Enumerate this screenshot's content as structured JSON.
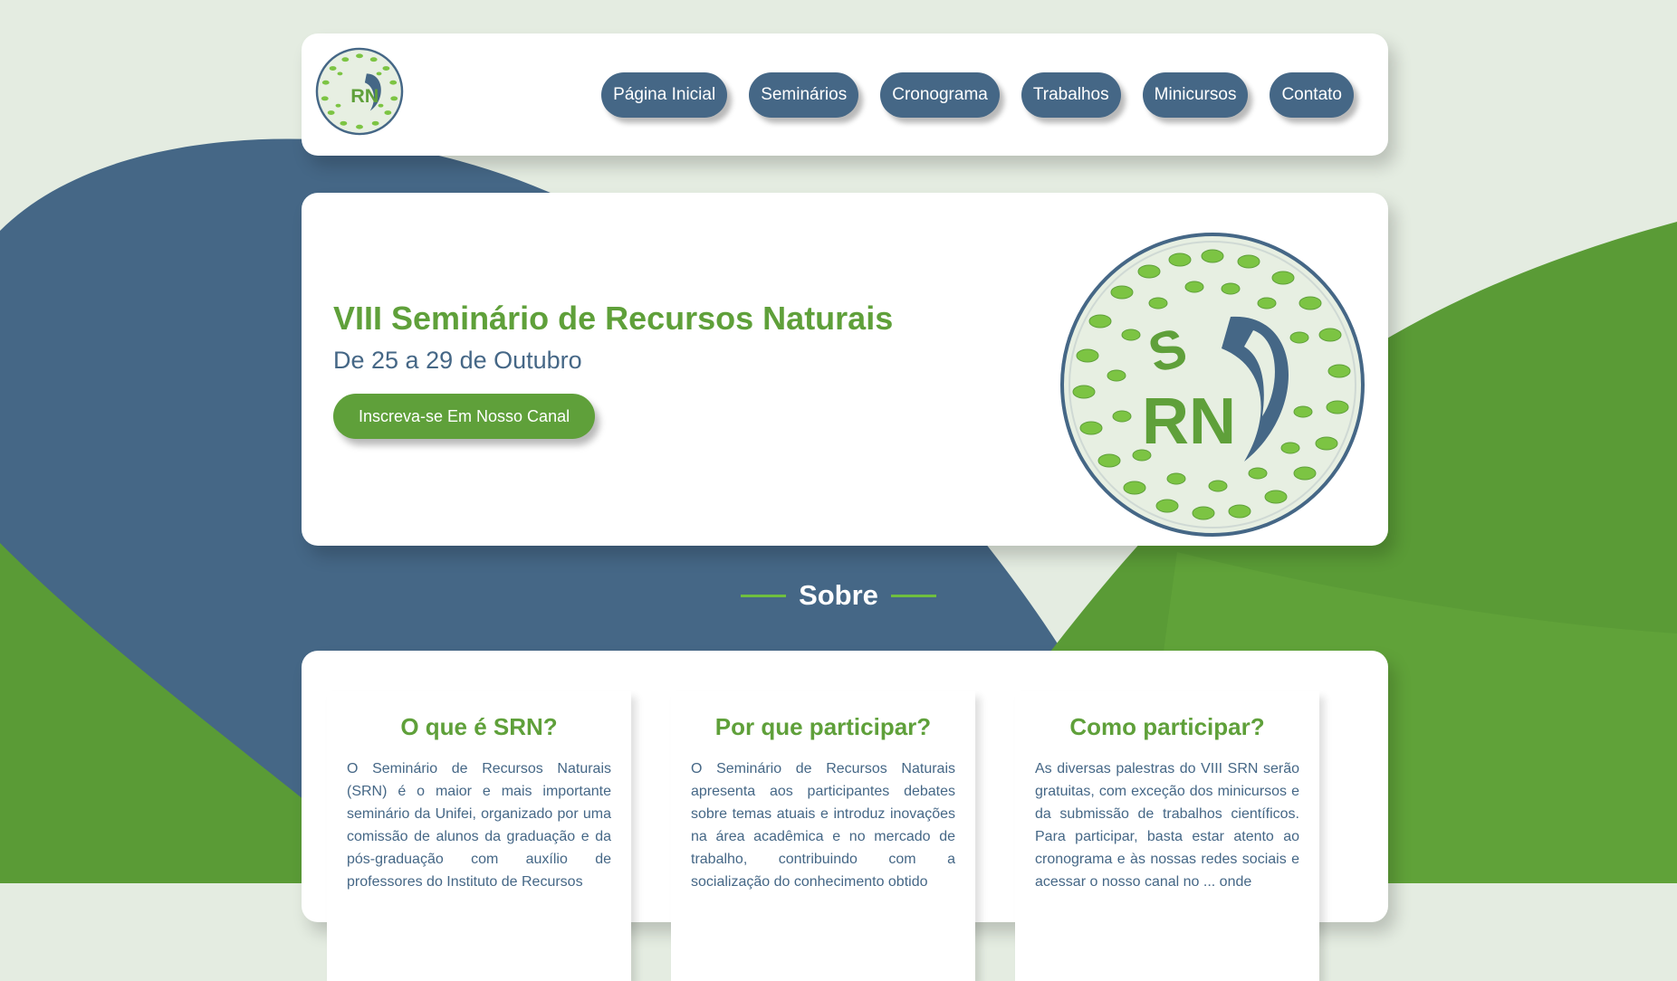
{
  "colors": {
    "accent_green": "#5fa03a",
    "brand_blue": "#456786",
    "background": "#e4ece1",
    "card": "#ffffff"
  },
  "header": {
    "logo_icon": "srn-logo-icon",
    "nav": [
      {
        "label": "Página Inicial"
      },
      {
        "label": "Seminários"
      },
      {
        "label": "Cronograma"
      },
      {
        "label": "Trabalhos"
      },
      {
        "label": "Minicursos"
      },
      {
        "label": "Contato"
      }
    ]
  },
  "hero": {
    "title": "VIII Seminário de Recursos Naturais",
    "subtitle": "De 25 a 29 de Outubro",
    "cta_label": "Inscreva-se Em Nosso Canal",
    "logo_icon": "srn-logo-icon",
    "logo_text": "SRN"
  },
  "about": {
    "section_title": "Sobre",
    "columns": [
      {
        "title": "O que é SRN?",
        "text": "O Seminário de Recursos Naturais (SRN) é o maior e mais importante seminário da Unifei, organizado por uma comissão de alunos da graduação e da pós-graduação com auxílio de professores do Instituto de Recursos"
      },
      {
        "title": "Por que participar?",
        "text": "O Seminário de Recursos Naturais apresenta aos participantes debates sobre temas atuais e introduz inovações na área acadêmica e no mercado de trabalho, contribuindo com a socialização do conhecimento obtido"
      },
      {
        "title": "Como participar?",
        "text": "As diversas palestras do VIII SRN serão gratuitas, com exceção dos minicursos e da submissão de trabalhos científicos. Para participar, basta estar atento ao cronograma e às nossas redes sociais e acessar o nosso canal no ... onde"
      }
    ]
  }
}
